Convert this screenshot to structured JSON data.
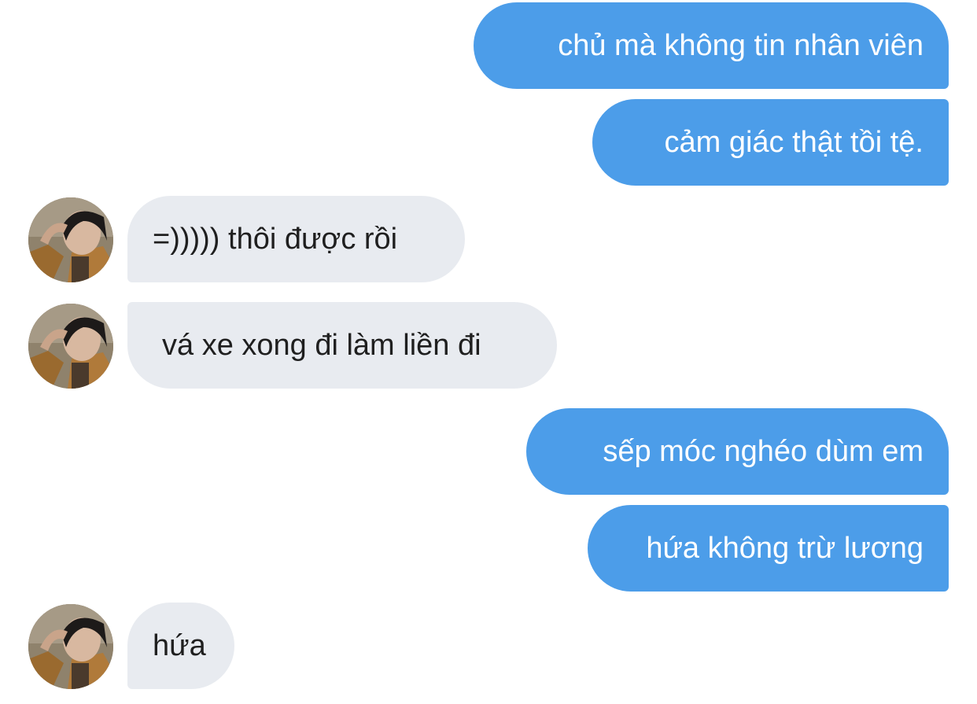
{
  "conversation": {
    "messages": [
      {
        "sender": "me",
        "text": "chủ mà không tin nhân viên"
      },
      {
        "sender": "me",
        "text": "cảm giác thật tồi tệ."
      },
      {
        "sender": "other",
        "text": "=))))) thôi được rồi"
      },
      {
        "sender": "other",
        "text": "vá xe xong đi làm liền đi"
      },
      {
        "sender": "me",
        "text": "sếp móc nghéo dùm em"
      },
      {
        "sender": "me",
        "text": "hứa không trừ lương"
      },
      {
        "sender": "other",
        "text": "hứa"
      }
    ]
  },
  "colors": {
    "outgoing_bubble": "#4c9de9",
    "incoming_bubble": "#e8ebf0",
    "outgoing_text": "#ffffff",
    "incoming_text": "#1f1f1f"
  },
  "icons": {
    "avatar": "contact-avatar-photo"
  }
}
